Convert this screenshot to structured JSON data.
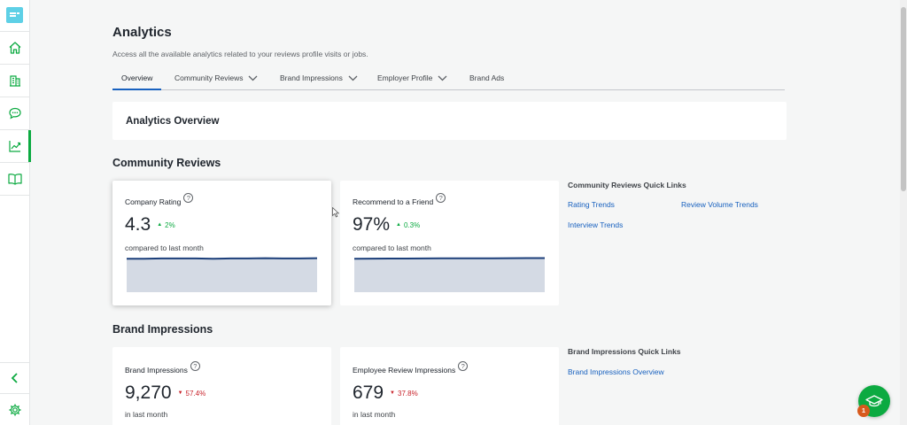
{
  "sidebar": {
    "items": [
      {
        "icon": "home-icon"
      },
      {
        "icon": "building-icon"
      },
      {
        "icon": "reviews-chat-icon"
      },
      {
        "icon": "analytics-chart-icon",
        "active": true
      },
      {
        "icon": "book-icon"
      }
    ],
    "bottom": [
      {
        "icon": "collapse-chevron-icon"
      },
      {
        "icon": "settings-gear-icon"
      }
    ]
  },
  "header": {
    "title": "Analytics",
    "subtitle": "Access all the available analytics related to your reviews profile visits or jobs."
  },
  "tabs": [
    {
      "label": "Overview",
      "active": true,
      "dropdown": false
    },
    {
      "label": "Community Reviews",
      "active": false,
      "dropdown": true
    },
    {
      "label": "Brand Impressions",
      "active": false,
      "dropdown": true
    },
    {
      "label": "Employer Profile",
      "active": false,
      "dropdown": true
    },
    {
      "label": "Brand Ads",
      "active": false,
      "dropdown": false
    }
  ],
  "overview_card": {
    "title": "Analytics Overview"
  },
  "community_reviews": {
    "title": "Community Reviews",
    "cards": [
      {
        "label": "Company Rating",
        "value": "4.3",
        "delta": "2%",
        "direction": "up",
        "compare": "compared to last month",
        "trend": [
          0.93,
          0.93,
          0.935,
          0.935,
          0.935,
          0.93,
          0.935,
          0.935,
          0.94,
          0.935,
          0.935,
          0.94
        ]
      },
      {
        "label": "Recommend to a Friend",
        "value": "97%",
        "delta": "0.3%",
        "direction": "up",
        "compare": "compared to last month",
        "trend": [
          0.93,
          0.932,
          0.933,
          0.934,
          0.935,
          0.936,
          0.937,
          0.938,
          0.939,
          0.94,
          0.941,
          0.942
        ]
      }
    ],
    "quick_links": {
      "title": "Community Reviews Quick Links",
      "links": [
        "Rating Trends",
        "Review Volume Trends",
        "Interview Trends"
      ]
    }
  },
  "brand_impressions": {
    "title": "Brand Impressions",
    "cards": [
      {
        "label": "Brand Impressions",
        "value": "9,270",
        "delta": "57.4%",
        "direction": "down",
        "compare": "in last month"
      },
      {
        "label": "Employee Review Impressions",
        "value": "679",
        "delta": "37.8%",
        "direction": "down",
        "compare": "in last month"
      }
    ],
    "quick_links": {
      "title": "Brand Impressions Quick Links",
      "links": [
        "Brand Impressions Overview"
      ]
    }
  },
  "help": {
    "badge_count": "1",
    "icon": "graduation-cap-icon"
  },
  "colors": {
    "brand_green": "#0caa41",
    "link_blue": "#1861bf",
    "up_green": "#0caa41",
    "down_red": "#c8222a",
    "spark_line": "#1c3f7a",
    "spark_fill": "#d4dae4"
  }
}
